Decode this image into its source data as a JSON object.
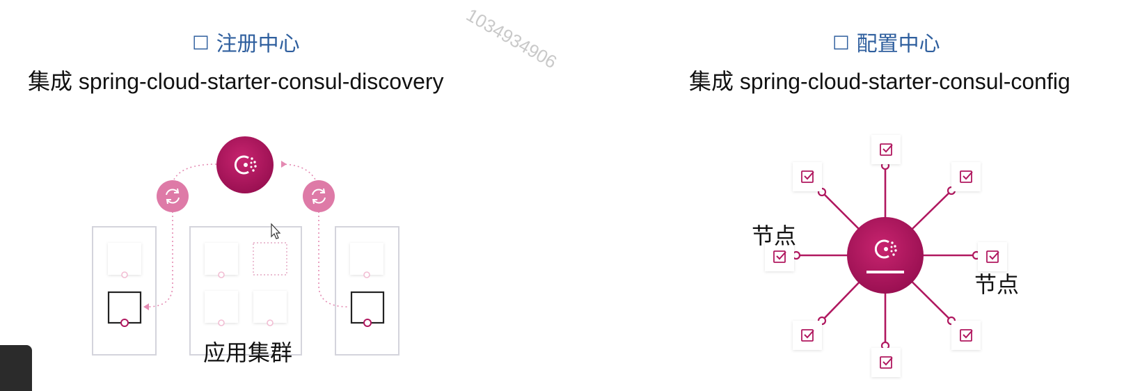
{
  "left": {
    "heading_icon": "□",
    "heading": "注册中心",
    "subtitle": "集成 spring-cloud-starter-consul-discovery",
    "cluster_label": "应用集群"
  },
  "right": {
    "heading_icon": "□",
    "heading": "配置中心",
    "subtitle": "集成 spring-cloud-starter-consul-config",
    "node_label_1": "节点",
    "node_label_2": "节点"
  },
  "watermark": "1034934906",
  "colors": {
    "heading_blue": "#2f5f9e",
    "consul_magenta": "#b0175f",
    "sync_pink": "#de7aa7",
    "box_border": "#d4d4dc"
  },
  "icons": [
    "consul-logo-icon",
    "sync-icon",
    "checkbox-icon",
    "mouse-cursor-icon"
  ]
}
